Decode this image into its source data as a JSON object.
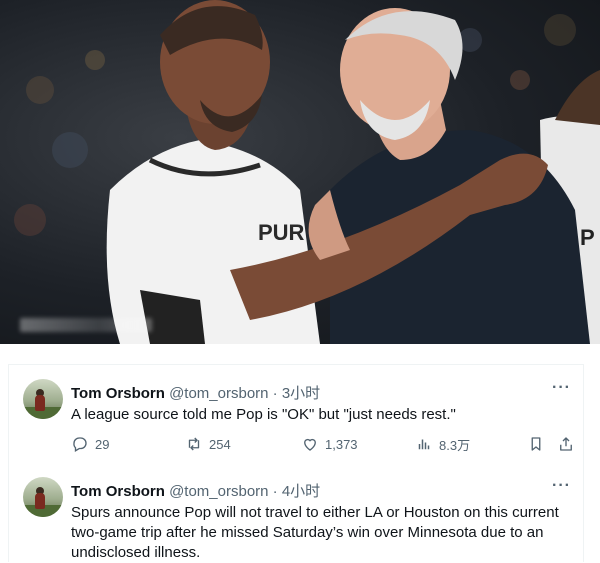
{
  "tweets": [
    {
      "name": "Tom Orsborn",
      "handle": "@tom_orsborn",
      "separator": "·",
      "time": "3小时",
      "more": "···",
      "text": "A league source told me Pop is \"OK\" but \"just needs rest.\"",
      "stats": {
        "replies": "29",
        "retweets": "254",
        "likes": "1,373",
        "views": "8.3万"
      }
    },
    {
      "name": "Tom Orsborn",
      "handle": "@tom_orsborn",
      "separator": "·",
      "time": "4小时",
      "more": "···",
      "text": "Spurs announce Pop will not travel to either LA or Houston on this current two-game trip after he missed Saturday’s win over Minnesota due to an undisclosed illness."
    }
  ],
  "icons": {
    "reply": "reply-icon",
    "retweet": "retweet-icon",
    "like": "like-icon",
    "views": "views-icon",
    "bookmark": "bookmark-icon",
    "share": "share-icon"
  },
  "colors": {
    "text": "#0f1419",
    "muted": "#536471",
    "border": "#eff3f4"
  }
}
